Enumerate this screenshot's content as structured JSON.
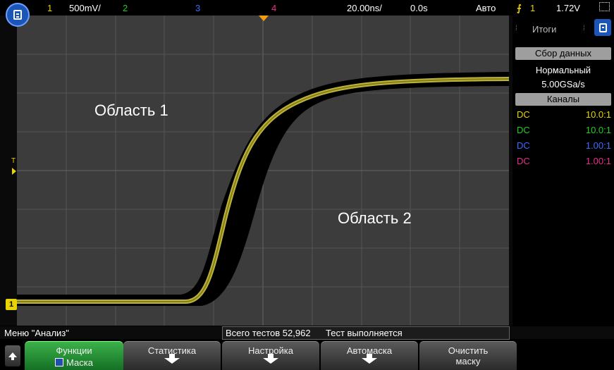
{
  "topbar": {
    "ch1_label": "1",
    "ch1_scale": "500mV/",
    "ch2_label": "2",
    "ch3_label": "3",
    "ch4_label": "4",
    "time_scale": "20.00ns/",
    "delay": "0.0s",
    "trigger_mode": "Авто",
    "trigger_channel": "1",
    "trigger_level": "1.72V"
  },
  "display": {
    "region1_label": "Область 1",
    "region2_label": "Область 2",
    "ch1_marker": "1"
  },
  "sidepanel": {
    "tab_label": "Итоги",
    "acquisition_header": "Сбор данных",
    "acquisition_mode": "Нормальный",
    "sample_rate": "5.00GSa/s",
    "channels_header": "Каналы",
    "channels": [
      {
        "coupling": "DC",
        "probe": "10.0:1",
        "color": "#e8d400"
      },
      {
        "coupling": "DC",
        "probe": "10.0:1",
        "color": "#22cc22"
      },
      {
        "coupling": "DC",
        "probe": "1.00:1",
        "color": "#3b6dff"
      },
      {
        "coupling": "DC",
        "probe": "1.00:1",
        "color": "#e62e8a"
      }
    ]
  },
  "status": {
    "menu_title": "Меню \"Анализ\"",
    "total_tests": "Всего тестов 52,962",
    "test_state": "Тест выполняется"
  },
  "softkeys": {
    "functions_label": "Функции",
    "mask_label": "Маска",
    "statistics_label": "Статистика",
    "setup_label": "Настройка",
    "automask_label": "Автомаска",
    "clear_label_line1": "Очистить",
    "clear_label_line2": "маску"
  },
  "colors": {
    "ch1": "#e8d400",
    "ch2": "#22cc22",
    "ch3": "#3b6dff",
    "ch4": "#e62e8a",
    "grid_background": "#3c3c3c",
    "mask_region": "#000000"
  }
}
